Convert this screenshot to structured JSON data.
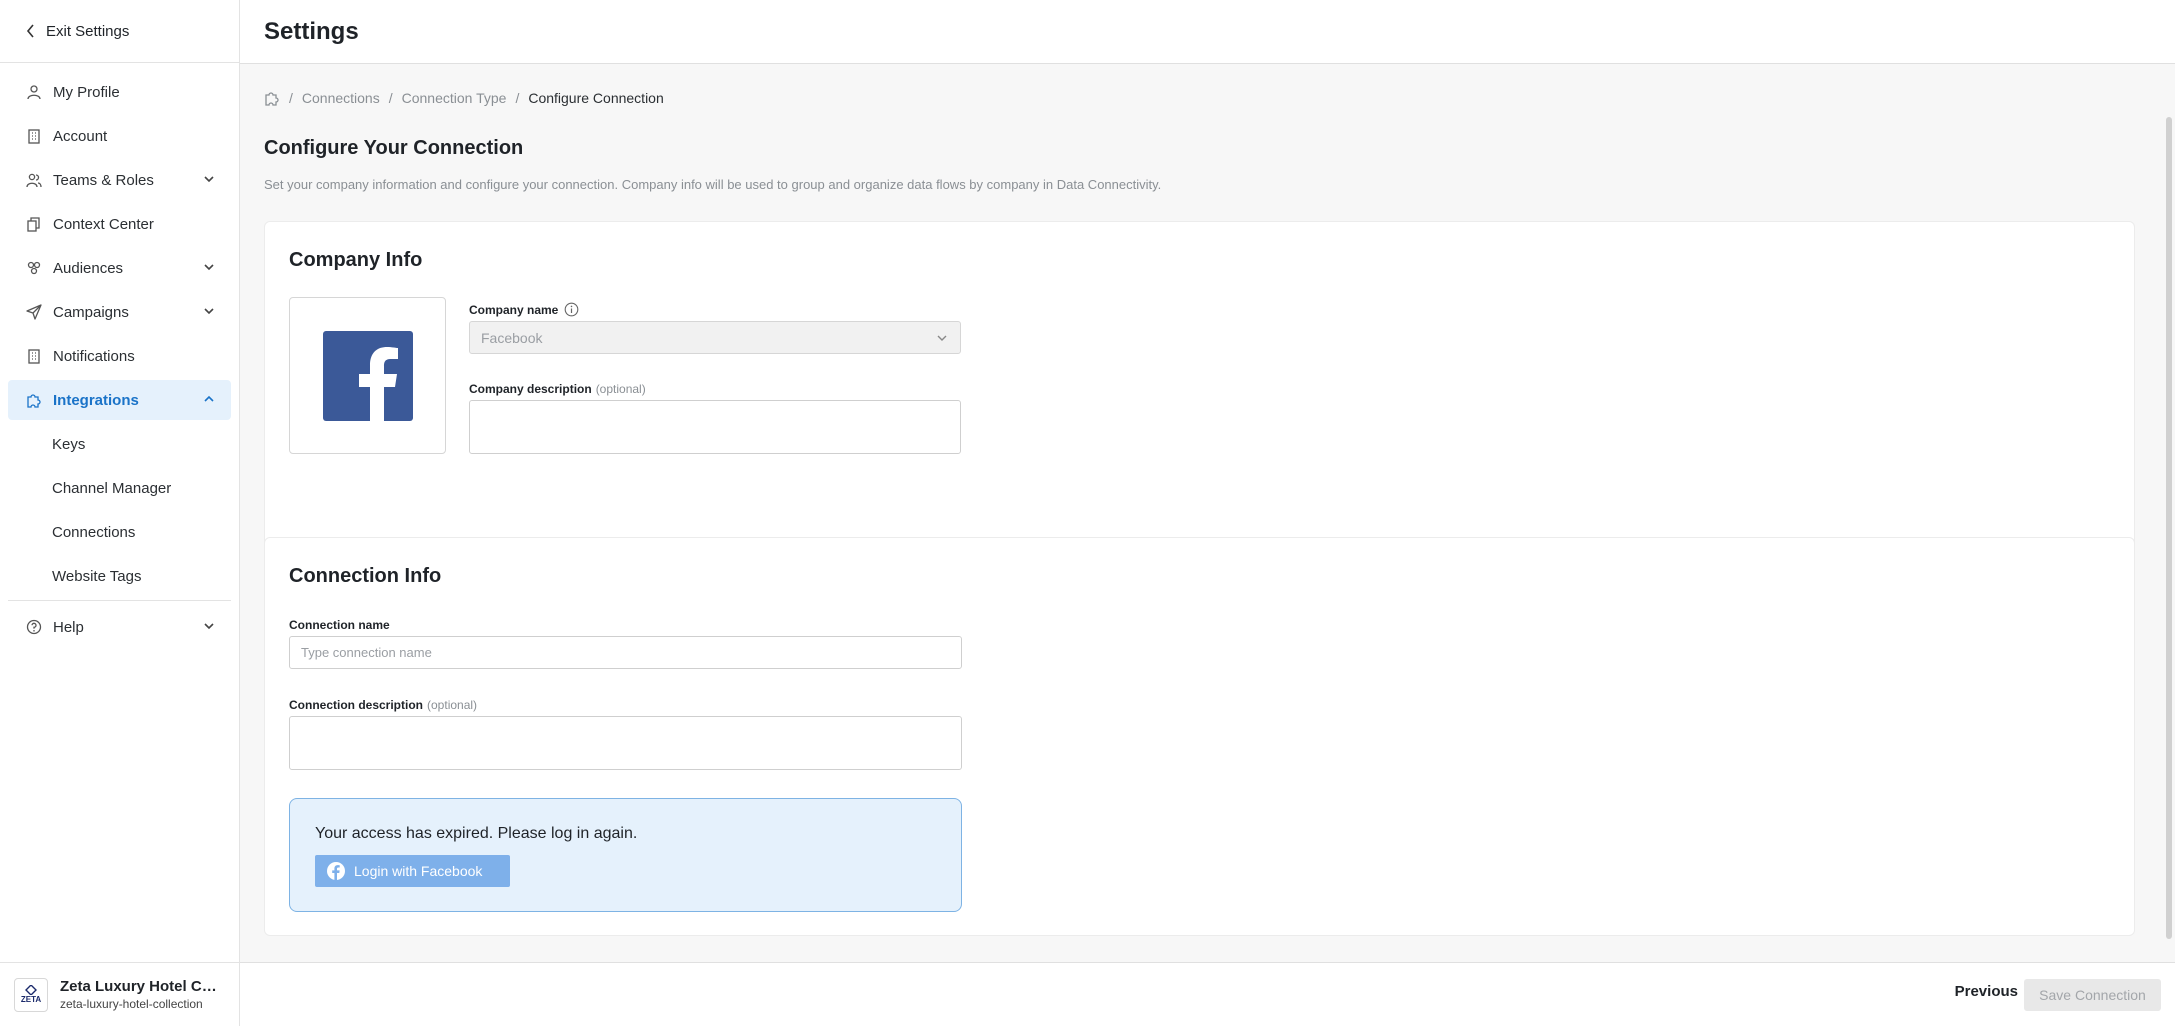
{
  "sidebar": {
    "exit_label": "Exit Settings",
    "items": [
      {
        "label": "My Profile",
        "icon": "user-icon"
      },
      {
        "label": "Account",
        "icon": "building-icon"
      },
      {
        "label": "Teams & Roles",
        "icon": "team-icon",
        "expandable": true
      },
      {
        "label": "Context Center",
        "icon": "documents-icon"
      },
      {
        "label": "Audiences",
        "icon": "audience-icon",
        "expandable": true
      },
      {
        "label": "Campaigns",
        "icon": "send-icon",
        "expandable": true
      },
      {
        "label": "Notifications",
        "icon": "building-icon"
      },
      {
        "label": "Integrations",
        "icon": "puzzle-icon",
        "expandable": true,
        "active": true
      }
    ],
    "sub_items": [
      {
        "label": "Keys"
      },
      {
        "label": "Channel Manager"
      },
      {
        "label": "Connections"
      },
      {
        "label": "Website Tags"
      }
    ],
    "help_label": "Help",
    "org": {
      "logo_text": "ZETA",
      "name": "Zeta Luxury Hotel Colle...",
      "slug": "zeta-luxury-hotel-collection"
    }
  },
  "header": {
    "title": "Settings"
  },
  "breadcrumb": {
    "items": [
      "Connections",
      "Connection Type"
    ],
    "current": "Configure Connection"
  },
  "page": {
    "heading": "Configure Your Connection",
    "description": "Set your company information and configure your connection. Company info will be used to group and organize data flows by company in Data Connectivity."
  },
  "company_info": {
    "title": "Company Info",
    "name_label": "Company name",
    "name_value": "Facebook",
    "description_label": "Company description",
    "optional_label": "(optional)"
  },
  "connection_info": {
    "title": "Connection Info",
    "name_label": "Connection name",
    "name_placeholder": "Type connection name",
    "description_label": "Connection description",
    "optional_label": "(optional)",
    "alert_text": "Your access has expired. Please log in again.",
    "login_button": "Login with Facebook"
  },
  "footer": {
    "previous_label": "Previous",
    "save_label": "Save Connection"
  },
  "colors": {
    "accent": "#1a73c8",
    "active_bg": "#e5f1fc",
    "facebook": "#3b5998",
    "login_button": "#7eb0ea"
  }
}
